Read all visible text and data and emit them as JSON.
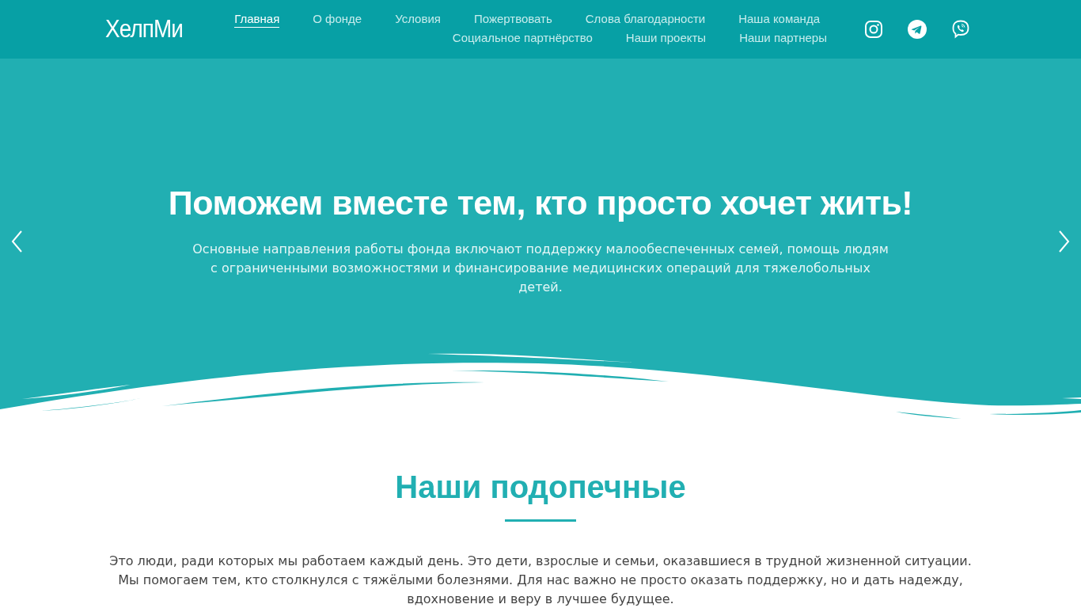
{
  "header": {
    "logo": "ХелпМи",
    "nav_rows": [
      [
        {
          "label": "Главная",
          "selected": true
        },
        {
          "label": "О фонде",
          "selected": false
        },
        {
          "label": "Условия",
          "selected": false
        },
        {
          "label": "Пожертвовать",
          "selected": false
        },
        {
          "label": "Слова благодарности",
          "selected": false
        },
        {
          "label": "Наша команда",
          "selected": false
        }
      ],
      [
        {
          "label": "Социальное партнёрство",
          "selected": false
        },
        {
          "label": "Наши проекты",
          "selected": false
        },
        {
          "label": "Наши партнеры",
          "selected": false
        }
      ]
    ],
    "social": [
      {
        "kind": "instagram"
      },
      {
        "kind": "telegram"
      },
      {
        "kind": "viber"
      }
    ]
  },
  "hero": {
    "title": "Поможем вместе тем, кто просто хочет жить!",
    "text": "Основные направления работы фонда включают поддержку малообеспеченных семей, помощь людям с ограниченными возможностями и финансирование медицинских операций для тяжелобольных детей."
  },
  "section": {
    "title": "Наши подопечные",
    "text": "Это люди, ради которых мы работаем каждый день. Это дети, взрослые и семьи, оказавшиеся в трудной жизненной ситуации. Мы помогаем тем, кто столкнулся с тяжёлыми болезнями. Для нас важно не просто оказать поддержку, но и дать надежду, вдохновение и веру в лучшее будущее."
  }
}
